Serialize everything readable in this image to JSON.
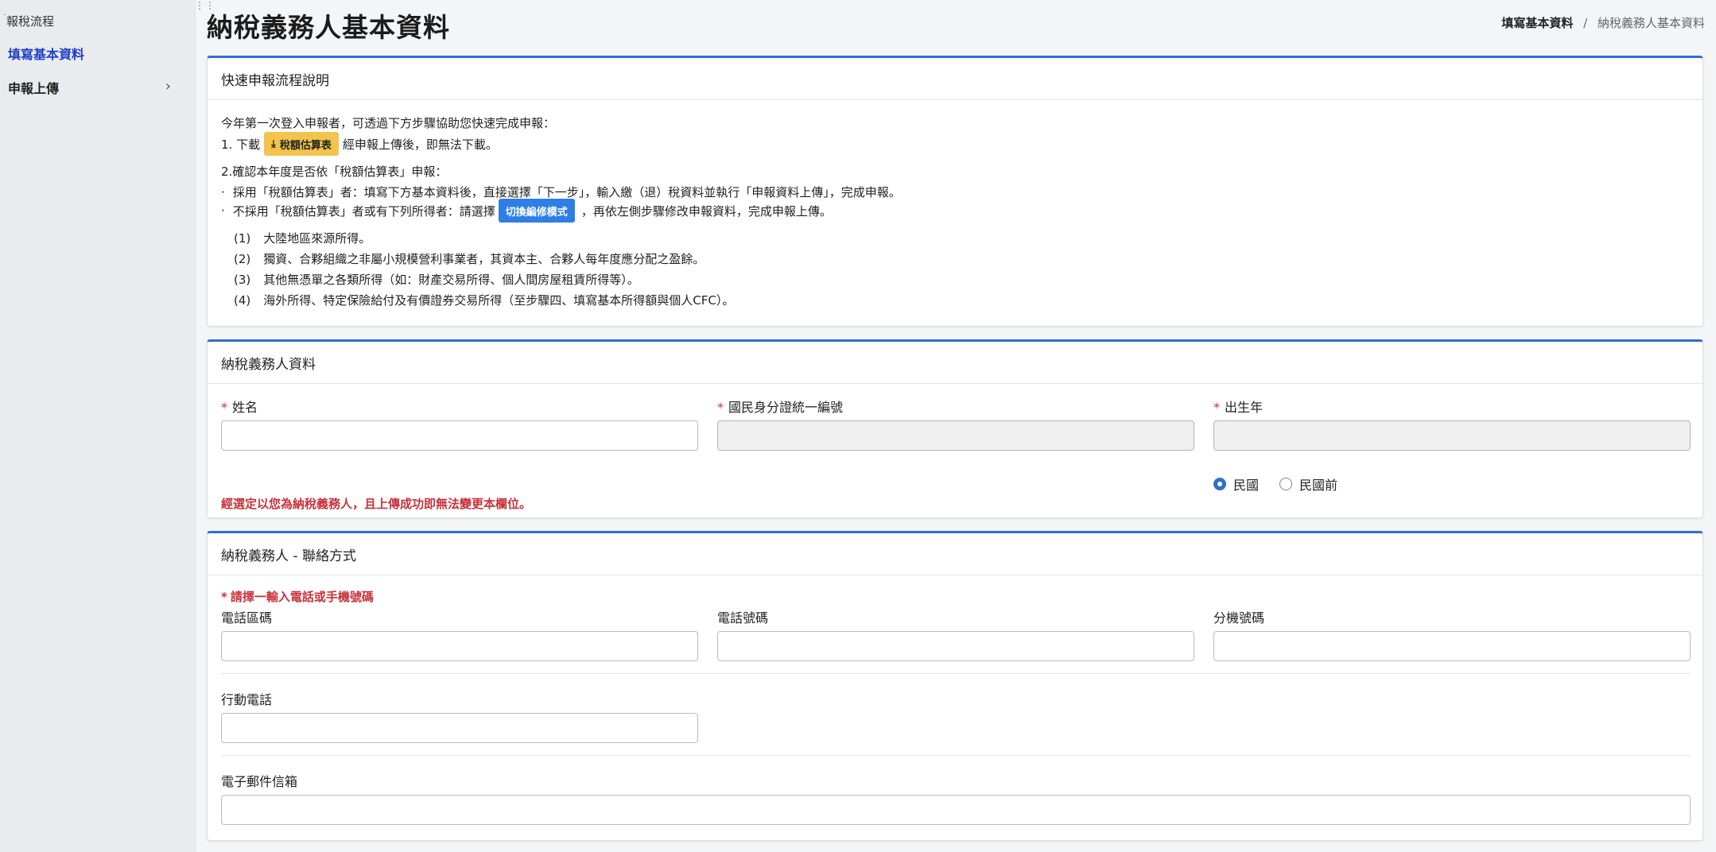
{
  "sidebar": {
    "heading": "報稅流程",
    "items": [
      {
        "label": "填寫基本資料"
      },
      {
        "label": "申報上傳"
      }
    ]
  },
  "header": {
    "title": "納稅義務人基本資料",
    "breadcrumb": [
      "填寫基本資料",
      "納稅義務人基本資料"
    ]
  },
  "flow_card": {
    "title": "快速申報流程說明",
    "intro": "今年第一次登入申報者，可透過下方步驟協助您快速完成申報：",
    "step1_prefix": "1. 下載",
    "step1_button": "稅額估算表",
    "step1_suffix": "經申報上傳後，即無法下載。",
    "step2": "2.確認本年度是否依「稅額估算表」申報：",
    "bullet1": "採用「稅額估算表」者：填寫下方基本資料後，直接選擇「下一步」，輸入繳（退）稅資料並執行「申報資料上傳」，完成申報。",
    "bullet2_prefix": "不採用「稅額估算表」者或有下列所得者：請選擇",
    "bullet2_button": "切換編修模式",
    "bullet2_suffix": "，再依左側步驟修改申報資料，完成申報上傳。",
    "items": [
      {
        "num": "(1)",
        "text": "大陸地區來源所得。"
      },
      {
        "num": "(2)",
        "text": "獨資、合夥組織之非屬小規模營利事業者，其資本主、合夥人每年度應分配之盈餘。"
      },
      {
        "num": "(3)",
        "text": "其他無憑單之各類所得（如：財產交易所得、個人間房屋租賃所得等）。"
      },
      {
        "num": "(4)",
        "text": "海外所得、特定保險給付及有價證券交易所得（至步驟四、填寫基本所得額與個人CFC）。"
      }
    ]
  },
  "taxpayer_card": {
    "title": "納稅義務人資料",
    "name_label": "姓名",
    "id_label": "國民身分證統一編號",
    "birth_label": "出生年",
    "radio_roc": "民國",
    "radio_pre_roc": "民國前",
    "notice": "經選定以您為納稅義務人，且上傳成功即無法變更本欄位。"
  },
  "contact_card": {
    "title": "納稅義務人 - 聯絡方式",
    "required_note": "請擇一輸入電話或手機號碼",
    "area_code_label": "電話區碼",
    "phone_label": "電話號碼",
    "ext_label": "分機號碼",
    "mobile_label": "行動電話",
    "email_label": "電子郵件信箱"
  },
  "colors": {
    "accent": "#2f6fcf",
    "warning_button": "#f3c44b",
    "primary_button": "#2f7ee6",
    "error_text": "#c8323a",
    "sidebar_active": "#1f3fc7"
  }
}
